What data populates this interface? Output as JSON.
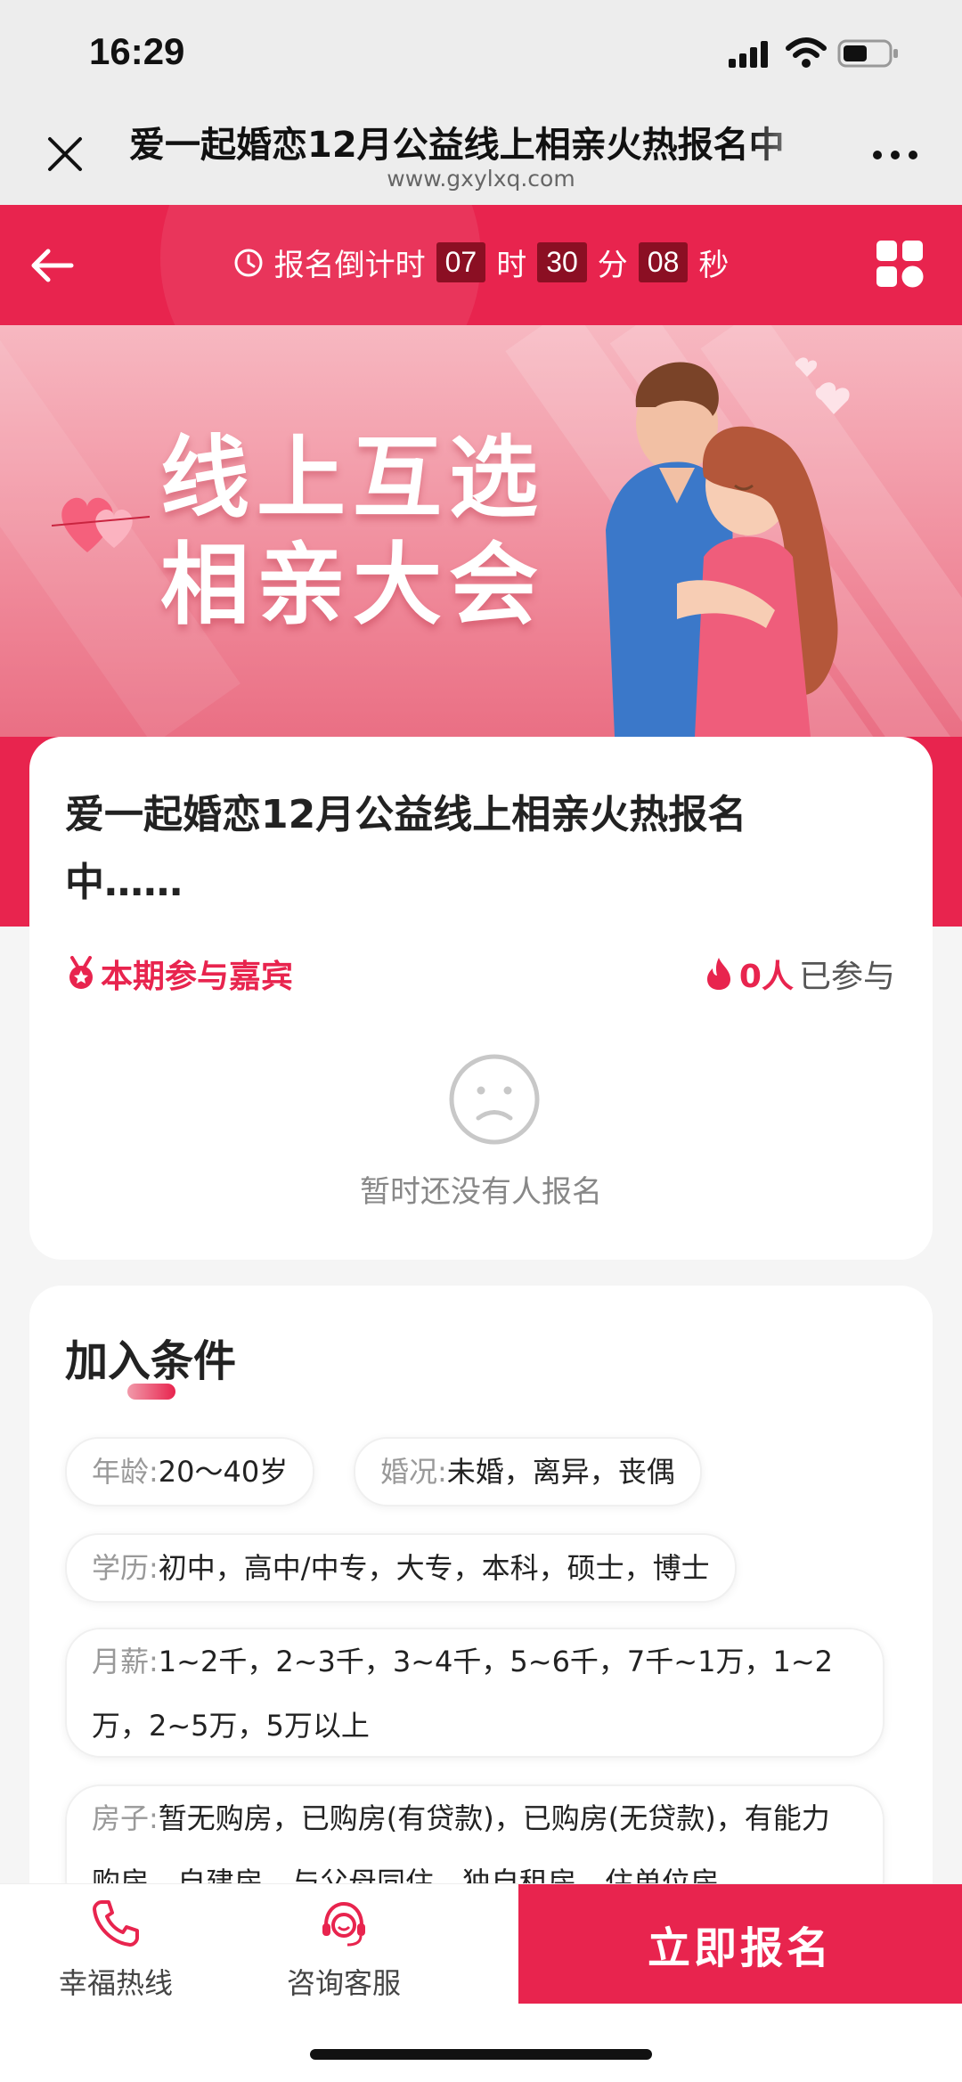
{
  "status_bar": {
    "time": "16:29"
  },
  "title_bar": {
    "title": "爱一起婚恋12月公益线上相亲火热报名中",
    "url": "www.gxylxq.com"
  },
  "countdown": {
    "prefix": "报名倒计时",
    "hours": "07",
    "hours_unit": "时",
    "minutes": "30",
    "minutes_unit": "分",
    "seconds": "08",
    "seconds_unit": "秒"
  },
  "banner": {
    "line1": "线上互选",
    "line2": "相亲大会"
  },
  "event": {
    "title": "爱一起婚恋12月公益线上相亲火热报名中……",
    "guests_label": "本期参与嘉宾",
    "participant_count": "0人",
    "participant_suffix": "已参与",
    "empty_text": "暂时还没有人报名"
  },
  "conditions": {
    "title": "加入条件",
    "age": {
      "label": "年龄:",
      "value": "20～40岁"
    },
    "marital": {
      "label": "婚况:",
      "value": "未婚，离异，丧偶"
    },
    "education": {
      "label": "学历:",
      "value": "初中，高中/中专，大专，本科，硕士，博士"
    },
    "salary": {
      "label": "月薪:",
      "value": "1~2千，2~3千，3~4千，5~6千，7千~1万，1~2万，2~5万，5万以上"
    },
    "house": {
      "label": "房子:",
      "value": "暂无购房，已购房(有贷款)，已购房(无贷款)，有能力购房，自建房，与父母同住，独自租房，住单位房"
    }
  },
  "bottom_bar": {
    "hotline_label": "幸福热线",
    "service_label": "咨询客服",
    "signup_label": "立即报名"
  },
  "colors": {
    "accent": "#e8244e",
    "countdown_box": "#8b0f23"
  },
  "icons": [
    "close-icon",
    "more-icon",
    "back-icon",
    "clock-icon",
    "grid-icon",
    "medal-icon",
    "flame-icon",
    "sad-face-icon",
    "phone-icon",
    "headset-icon"
  ]
}
